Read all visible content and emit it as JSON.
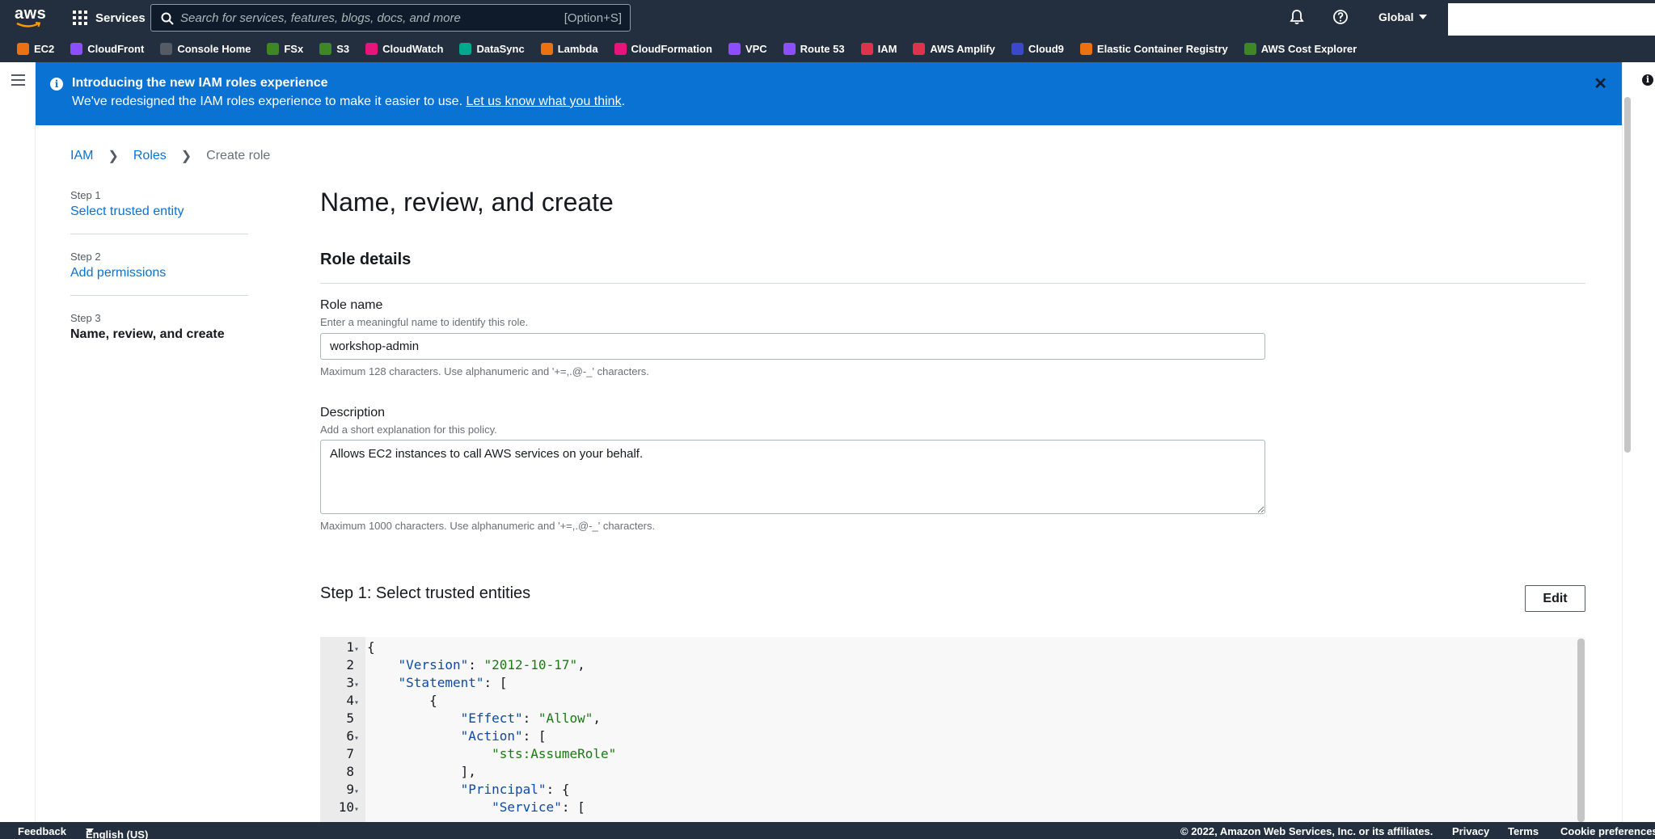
{
  "topnav": {
    "logo_text": "aws",
    "services_label": "Services",
    "search_placeholder": "Search for services, features, blogs, docs, and more",
    "search_shortcut": "[Option+S]",
    "region_label": "Global"
  },
  "favorites": [
    {
      "label": "EC2",
      "icon": "ec2-icon",
      "color": "#ec7211"
    },
    {
      "label": "CloudFront",
      "icon": "cloudfront-icon",
      "color": "#8c4fff"
    },
    {
      "label": "Console Home",
      "icon": "console-home-icon",
      "color": "#545b64"
    },
    {
      "label": "FSx",
      "icon": "fsx-icon",
      "color": "#3f8624"
    },
    {
      "label": "S3",
      "icon": "s3-icon",
      "color": "#3f8624"
    },
    {
      "label": "CloudWatch",
      "icon": "cloudwatch-icon",
      "color": "#e7157b"
    },
    {
      "label": "DataSync",
      "icon": "datasync-icon",
      "color": "#01a88d"
    },
    {
      "label": "Lambda",
      "icon": "lambda-icon",
      "color": "#ec7211"
    },
    {
      "label": "CloudFormation",
      "icon": "cloudformation-icon",
      "color": "#e7157b"
    },
    {
      "label": "VPC",
      "icon": "vpc-icon",
      "color": "#8c4fff"
    },
    {
      "label": "Route 53",
      "icon": "route53-icon",
      "color": "#8c4fff"
    },
    {
      "label": "IAM",
      "icon": "iam-icon",
      "color": "#dd344c"
    },
    {
      "label": "AWS Amplify",
      "icon": "amplify-icon",
      "color": "#dd344c"
    },
    {
      "label": "Cloud9",
      "icon": "cloud9-icon",
      "color": "#3b48cc"
    },
    {
      "label": "Elastic Container Registry",
      "icon": "ecr-icon",
      "color": "#ec7211"
    },
    {
      "label": "AWS Cost Explorer",
      "icon": "cost-explorer-icon",
      "color": "#3f8624"
    }
  ],
  "flash": {
    "title": "Introducing the new IAM roles experience",
    "message": "We've redesigned the IAM roles experience to make it easier to use.",
    "link": "Let us know what you think",
    "suffix": "."
  },
  "breadcrumb": {
    "items": [
      "IAM",
      "Roles"
    ],
    "current": "Create role"
  },
  "steps": [
    {
      "num": "Step 1",
      "label": "Select trusted entity"
    },
    {
      "num": "Step 2",
      "label": "Add permissions"
    },
    {
      "num": "Step 3",
      "label": "Name, review, and create"
    }
  ],
  "main": {
    "title": "Name, review, and create",
    "section_title": "Role details",
    "role_name_label": "Role name",
    "role_name_desc": "Enter a meaningful name to identify this role.",
    "role_name_value": "workshop-admin",
    "role_name_hint": "Maximum 128 characters. Use alphanumeric and '+=,.@-_' characters.",
    "description_label": "Description",
    "description_desc": "Add a short explanation for this policy.",
    "description_value": "Allows EC2 instances to call AWS services on your behalf.",
    "description_hint": "Maximum 1000 characters. Use alphanumeric and '+=,.@-_' characters.",
    "step1_title": "Step 1: Select trusted entities",
    "edit_label": "Edit"
  },
  "code_lines": [
    {
      "n": "1",
      "fold": true,
      "text": "{"
    },
    {
      "n": "2",
      "fold": false,
      "text": "    \"Version\": \"2012-10-17\","
    },
    {
      "n": "3",
      "fold": true,
      "text": "    \"Statement\": ["
    },
    {
      "n": "4",
      "fold": true,
      "text": "        {"
    },
    {
      "n": "5",
      "fold": false,
      "text": "            \"Effect\": \"Allow\","
    },
    {
      "n": "6",
      "fold": true,
      "text": "            \"Action\": ["
    },
    {
      "n": "7",
      "fold": false,
      "text": "                \"sts:AssumeRole\""
    },
    {
      "n": "8",
      "fold": false,
      "text": "            ],"
    },
    {
      "n": "9",
      "fold": true,
      "text": "            \"Principal\": {"
    },
    {
      "n": "10",
      "fold": true,
      "text": "                \"Service\": ["
    }
  ],
  "footer": {
    "feedback": "Feedback",
    "language": "English (US)",
    "copyright": "© 2022, Amazon Web Services, Inc. or its affiliates.",
    "privacy": "Privacy",
    "terms": "Terms",
    "cookies": "Cookie preferences"
  },
  "colors": {
    "nav_bg": "#232f3e",
    "flash_bg": "#0972d3",
    "link": "#0972d3"
  }
}
